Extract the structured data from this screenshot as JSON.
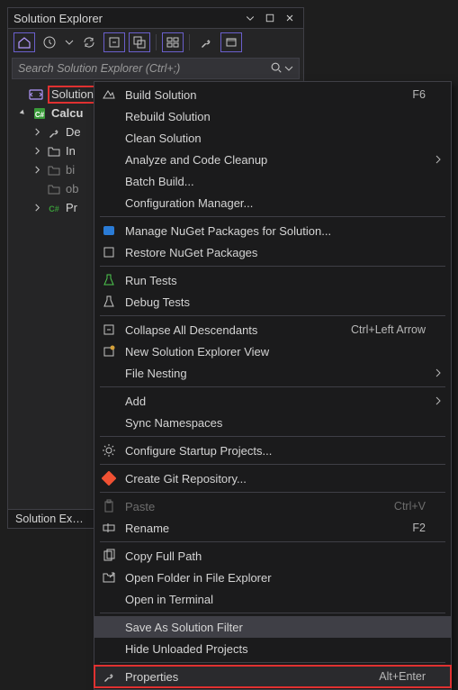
{
  "panel": {
    "title": "Solution Explorer",
    "footer": "Solution Ex…"
  },
  "search": {
    "placeholder": "Search Solution Explorer (Ctrl+;)"
  },
  "tree": {
    "solution_label": "Solution",
    "items": [
      {
        "label": "Calcu",
        "icon": "csproj"
      },
      {
        "label": "De",
        "icon": "wrench"
      },
      {
        "label": "In",
        "icon": "folder"
      },
      {
        "label": "bi",
        "icon": "folder"
      },
      {
        "label": "ob",
        "icon": "folder"
      },
      {
        "label": "Pr",
        "icon": "cs"
      }
    ]
  },
  "menu": {
    "build_solution": {
      "label": "Build Solution",
      "shortcut": "F6"
    },
    "rebuild_solution": {
      "label": "Rebuild Solution"
    },
    "clean_solution": {
      "label": "Clean Solution"
    },
    "analyze": {
      "label": "Analyze and Code Cleanup"
    },
    "batch_build": {
      "label": "Batch Build..."
    },
    "config_mgr": {
      "label": "Configuration Manager..."
    },
    "manage_nuget": {
      "label": "Manage NuGet Packages for Solution..."
    },
    "restore_nuget": {
      "label": "Restore NuGet Packages"
    },
    "run_tests": {
      "label": "Run Tests"
    },
    "debug_tests": {
      "label": "Debug Tests"
    },
    "collapse_all": {
      "label": "Collapse All Descendants",
      "shortcut": "Ctrl+Left Arrow"
    },
    "new_view": {
      "label": "New Solution Explorer View"
    },
    "file_nesting": {
      "label": "File Nesting"
    },
    "add": {
      "label": "Add"
    },
    "sync_ns": {
      "label": "Sync Namespaces"
    },
    "startup": {
      "label": "Configure Startup Projects..."
    },
    "git": {
      "label": "Create Git Repository..."
    },
    "paste": {
      "label": "Paste",
      "shortcut": "Ctrl+V"
    },
    "rename": {
      "label": "Rename",
      "shortcut": "F2"
    },
    "copy_path": {
      "label": "Copy Full Path"
    },
    "open_folder": {
      "label": "Open Folder in File Explorer"
    },
    "open_terminal": {
      "label": "Open in Terminal"
    },
    "save_filter": {
      "label": "Save As Solution Filter"
    },
    "hide_unloaded": {
      "label": "Hide Unloaded Projects"
    },
    "properties": {
      "label": "Properties",
      "shortcut": "Alt+Enter"
    }
  }
}
